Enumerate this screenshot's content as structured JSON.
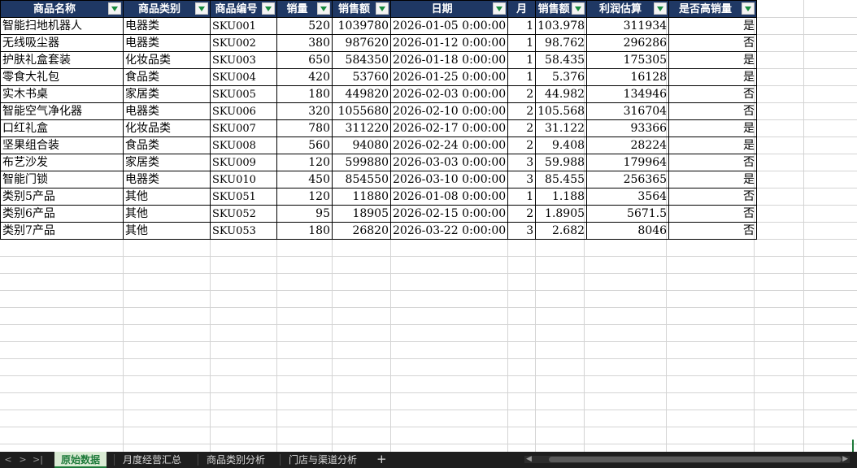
{
  "sheet": {
    "headers": [
      "商品名称",
      "商品类别",
      "商品编号",
      "销量",
      "销售额",
      "日期",
      "月",
      "销售额",
      "利润估算",
      "是否高销量"
    ],
    "rows": [
      [
        "智能扫地机器人",
        "电器类",
        "SKU001",
        "520",
        "1039780",
        "2026-01-05 0:00:00",
        "1",
        "103.978",
        "311934",
        "是"
      ],
      [
        "无线吸尘器",
        "电器类",
        "SKU002",
        "380",
        "987620",
        "2026-01-12 0:00:00",
        "1",
        "98.762",
        "296286",
        "否"
      ],
      [
        "护肤礼盒套装",
        "化妆品类",
        "SKU003",
        "650",
        "584350",
        "2026-01-18 0:00:00",
        "1",
        "58.435",
        "175305",
        "是"
      ],
      [
        "零食大礼包",
        "食品类",
        "SKU004",
        "420",
        "53760",
        "2026-01-25 0:00:00",
        "1",
        "5.376",
        "16128",
        "是"
      ],
      [
        "实木书桌",
        "家居类",
        "SKU005",
        "180",
        "449820",
        "2026-02-03 0:00:00",
        "2",
        "44.982",
        "134946",
        "否"
      ],
      [
        "智能空气净化器",
        "电器类",
        "SKU006",
        "320",
        "1055680",
        "2026-02-10 0:00:00",
        "2",
        "105.568",
        "316704",
        "否"
      ],
      [
        "口红礼盒",
        "化妆品类",
        "SKU007",
        "780",
        "311220",
        "2026-02-17 0:00:00",
        "2",
        "31.122",
        "93366",
        "是"
      ],
      [
        "坚果组合装",
        "食品类",
        "SKU008",
        "560",
        "94080",
        "2026-02-24 0:00:00",
        "2",
        "9.408",
        "28224",
        "是"
      ],
      [
        "布艺沙发",
        "家居类",
        "SKU009",
        "120",
        "599880",
        "2026-03-03 0:00:00",
        "3",
        "59.988",
        "179964",
        "否"
      ],
      [
        "智能门锁",
        "电器类",
        "SKU010",
        "450",
        "854550",
        "2026-03-10 0:00:00",
        "3",
        "85.455",
        "256365",
        "是"
      ],
      [
        "类别5产品",
        "其他",
        "SKU051",
        "120",
        "11880",
        "2026-01-08 0:00:00",
        "1",
        "1.188",
        "3564",
        "否"
      ],
      [
        "类别6产品",
        "其他",
        "SKU052",
        "95",
        "18905",
        "2026-02-15 0:00:00",
        "2",
        "1.8905",
        "5671.5",
        "否"
      ],
      [
        "类别7产品",
        "其他",
        "SKU053",
        "180",
        "26820",
        "2026-03-22 0:00:00",
        "3",
        "2.682",
        "8046",
        "否"
      ]
    ]
  },
  "tabs": {
    "nav": [
      "<",
      ">",
      ">|"
    ],
    "items": [
      "原始数据",
      "月度经营汇总",
      "商品类别分析",
      "门店与渠道分析"
    ],
    "add": "+",
    "active_index": 0
  },
  "colors": {
    "header_bg": "#1f3864",
    "active_tab": "#d9ead3",
    "accent": "#1e7a3a"
  }
}
